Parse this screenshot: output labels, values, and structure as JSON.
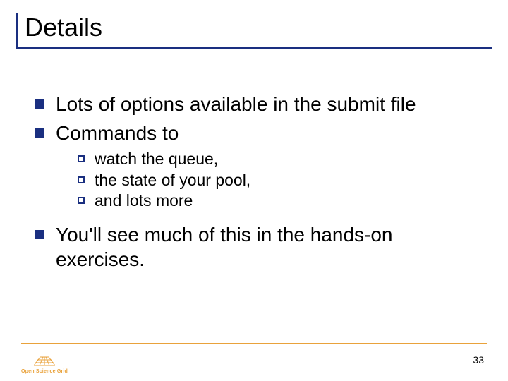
{
  "title": "Details",
  "bullets": [
    {
      "text": "Lots of options available in the submit file"
    },
    {
      "text": "Commands to",
      "sub": [
        "watch the queue,",
        "the state of your pool,",
        "and lots more"
      ]
    },
    {
      "text": "You'll see much of this in the hands-on exercises."
    }
  ],
  "footer": {
    "logo_text": "Open Science Grid",
    "page_number": "33"
  },
  "colors": {
    "accent": "#1a2f80",
    "rule": "#e9a23b"
  }
}
